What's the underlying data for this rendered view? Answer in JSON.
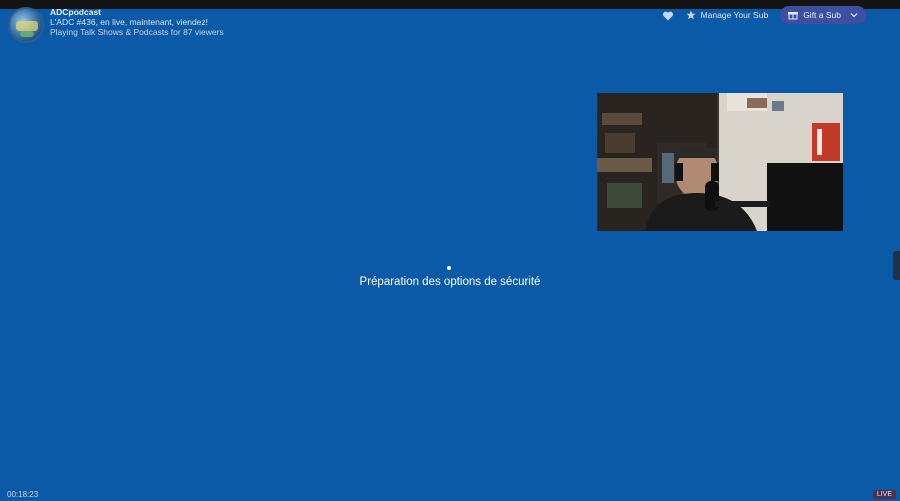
{
  "channel": {
    "name": "ADCpodcast",
    "stream_title": "L'ADC #436, en live, maintenant, viendez!",
    "category_line": "Playing Talk Shows & Podcasts for 87 viewers"
  },
  "actions": {
    "follow_icon": "heart-icon",
    "manage_sub_label": "Manage Your Sub",
    "manage_sub_icon": "star-icon",
    "gift_sub_label": "Gift a Sub",
    "gift_sub_icon": "gift-icon"
  },
  "screen": {
    "status_text": "Préparation des options de sécurité",
    "background_color": "#0a5aa8"
  },
  "player": {
    "elapsed_time": "00:18:23",
    "live_label": "LIVE"
  }
}
